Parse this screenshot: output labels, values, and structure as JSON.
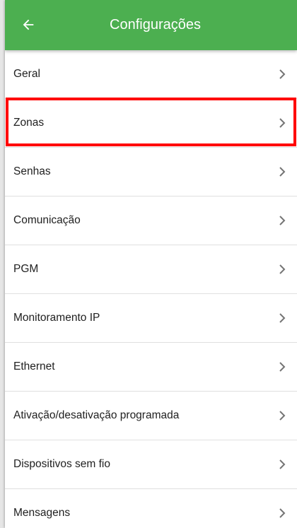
{
  "colors": {
    "appbar": "#4caf50",
    "highlight": "#ff0000",
    "text": "#212121",
    "chevron": "#757575"
  },
  "header": {
    "title": "Configurações",
    "back_icon": "arrow-left-icon"
  },
  "settings": {
    "items": [
      {
        "label": "Geral"
      },
      {
        "label": "Zonas"
      },
      {
        "label": "Senhas"
      },
      {
        "label": "Comunicação"
      },
      {
        "label": "PGM"
      },
      {
        "label": "Monitoramento IP"
      },
      {
        "label": "Ethernet"
      },
      {
        "label": "Ativação/desativação programada"
      },
      {
        "label": "Dispositivos sem fio"
      },
      {
        "label": "Mensagens"
      }
    ],
    "item_icon": "chevron-right-icon",
    "highlighted_item": "Zonas"
  }
}
